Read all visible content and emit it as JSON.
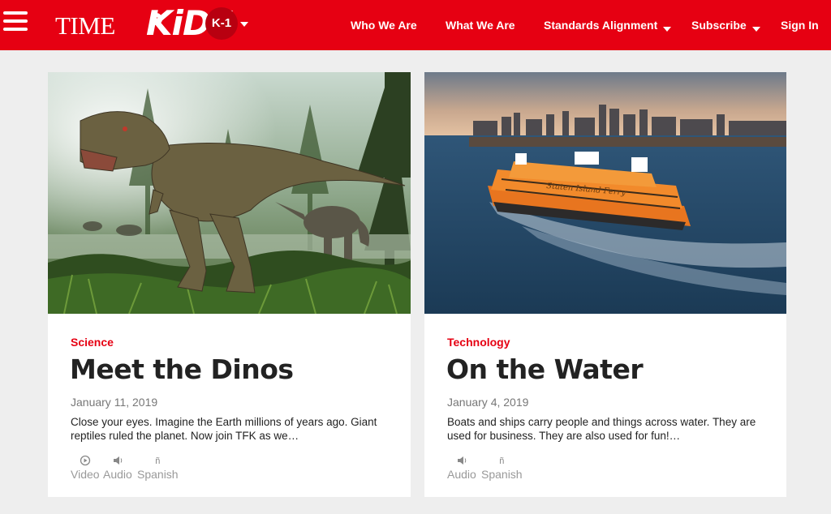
{
  "header": {
    "logo_time": "TIME",
    "logo_for": "for",
    "logo_kids": "KiDS",
    "grade": "K-1",
    "nav": {
      "who": "Who We Are",
      "what": "What We Are",
      "standards": "Standards Alignment",
      "subscribe": "Subscribe",
      "signin": "Sign In"
    },
    "colors": {
      "brand_red": "#e60012",
      "grade_badge": "#b80010"
    }
  },
  "articles": [
    {
      "category": "Science",
      "title": "Meet the Dinos",
      "date": "January 11, 2019",
      "summary": "Close your eyes. Imagine the Earth millions of years ago. Giant reptiles ruled the planet. Now join TFK as we…",
      "media": {
        "video": "Video",
        "audio": "Audio",
        "spanish": "Spanish"
      },
      "icons": {
        "video": "play-circle-icon",
        "audio": "speaker-icon",
        "spanish": "enye-icon"
      }
    },
    {
      "category": "Technology",
      "title": "On the Water",
      "date": "January 4, 2019",
      "summary": "Boats and ships carry people and things across water. They are used for business. They are also used for fun!…",
      "media": {
        "audio": "Audio",
        "spanish": "Spanish"
      },
      "icons": {
        "audio": "speaker-icon",
        "spanish": "enye-icon"
      }
    }
  ],
  "images": {
    "left": "tyrannosaurus-in-forest",
    "right": "orange-ferry-on-water-city-skyline",
    "ferry_text": "Staten Island Ferry"
  }
}
